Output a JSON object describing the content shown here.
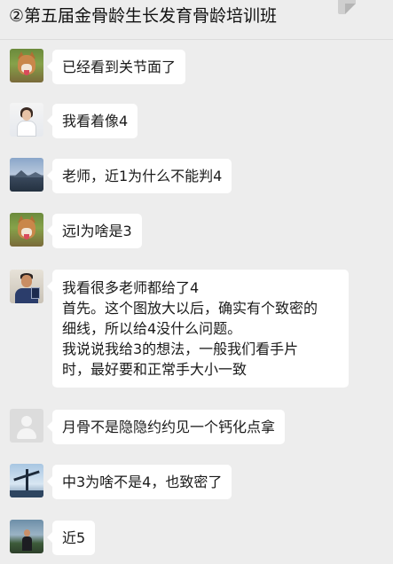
{
  "chat": {
    "title": "②第五届金骨龄生长发育骨龄培训班"
  },
  "messages": [
    {
      "avatar": "dog-avatar",
      "lines": [
        "已经看到关节面了"
      ]
    },
    {
      "avatar": "woman-avatar",
      "lines": [
        "我看着像4"
      ]
    },
    {
      "avatar": "landscape-avatar",
      "lines": [
        "老师，近1为什么不能判4"
      ]
    },
    {
      "avatar": "dog-avatar",
      "lines": [
        "远l为啥是3"
      ]
    },
    {
      "avatar": "man-avatar",
      "lines": [
        "我看很多老师都给了4",
        "首先。这个图放大以后，确实有个致密的",
        "细线，所以给4没什么问题。",
        "我说说我给3的想法，一般我们看手片",
        "时，最好要和正常手大小一致"
      ]
    },
    {
      "avatar": "default-avatar",
      "lines": [
        "月骨不是隐隐约约见一个钙化点拿"
      ]
    },
    {
      "avatar": "bridge-avatar",
      "lines": [
        "中3为啥不是4，也致密了"
      ]
    },
    {
      "avatar": "person-avatar",
      "lines": [
        "近5"
      ]
    }
  ]
}
